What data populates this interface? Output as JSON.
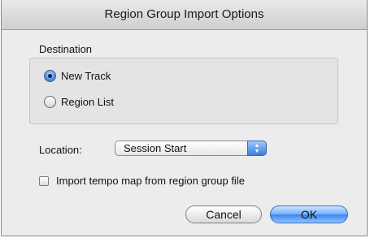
{
  "window": {
    "title": "Region Group Import Options"
  },
  "destination": {
    "label": "Destination",
    "options": [
      {
        "label": "New Track",
        "selected": true
      },
      {
        "label": "Region List",
        "selected": false
      }
    ]
  },
  "location": {
    "label": "Location:",
    "selected_value": "Session Start"
  },
  "import_tempo": {
    "label": "Import tempo map from region group file",
    "checked": false
  },
  "buttons": {
    "cancel_label": "Cancel",
    "ok_label": "OK"
  },
  "colors": {
    "accent": "#3b86ec",
    "dialog_bg": "#ececec"
  }
}
